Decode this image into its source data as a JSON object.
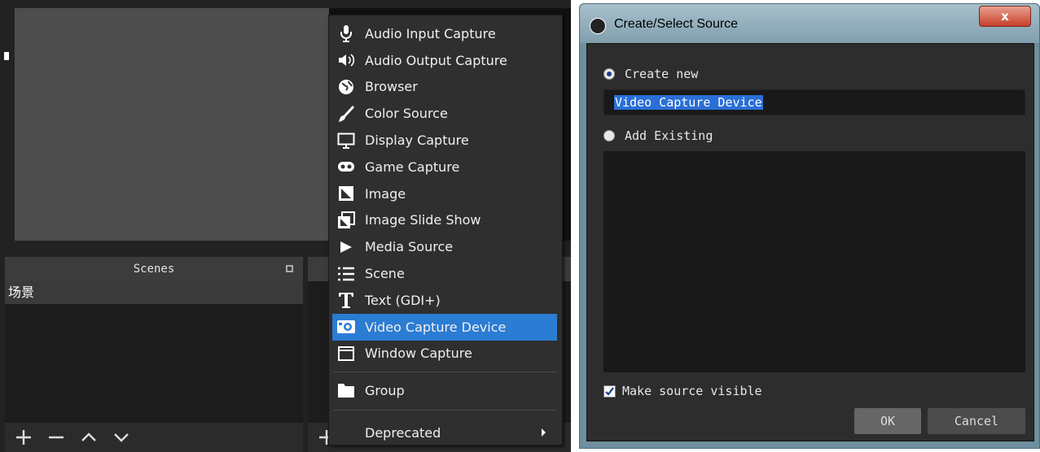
{
  "obs": {
    "scenes_dock": {
      "title": "Scenes",
      "items": [
        "场景"
      ]
    },
    "context_menu": {
      "items": [
        {
          "label": "Audio Input Capture",
          "icon": "microphone-icon"
        },
        {
          "label": "Audio Output Capture",
          "icon": "speaker-icon"
        },
        {
          "label": "Browser",
          "icon": "globe-icon"
        },
        {
          "label": "Color Source",
          "icon": "brush-icon"
        },
        {
          "label": "Display Capture",
          "icon": "monitor-icon"
        },
        {
          "label": "Game Capture",
          "icon": "gamepad-icon"
        },
        {
          "label": "Image",
          "icon": "image-icon"
        },
        {
          "label": "Image Slide Show",
          "icon": "slideshow-icon"
        },
        {
          "label": "Media Source",
          "icon": "play-icon"
        },
        {
          "label": "Scene",
          "icon": "list-icon"
        },
        {
          "label": "Text (GDI+)",
          "icon": "text-icon"
        },
        {
          "label": "Video Capture Device",
          "icon": "camera-icon",
          "selected": true
        },
        {
          "label": "Window Capture",
          "icon": "window-icon"
        }
      ],
      "group_label": "Group",
      "deprecated_label": "Deprecated",
      "selection_color": "#2b7cd3"
    }
  },
  "dialog": {
    "title": "Create/Select Source",
    "close_label": "x",
    "create_new_label": "Create new",
    "name_value": "Video Capture Device",
    "add_existing_label": "Add Existing",
    "make_visible_label": "Make source visible",
    "make_visible_checked": true,
    "ok_label": "OK",
    "cancel_label": "Cancel"
  }
}
